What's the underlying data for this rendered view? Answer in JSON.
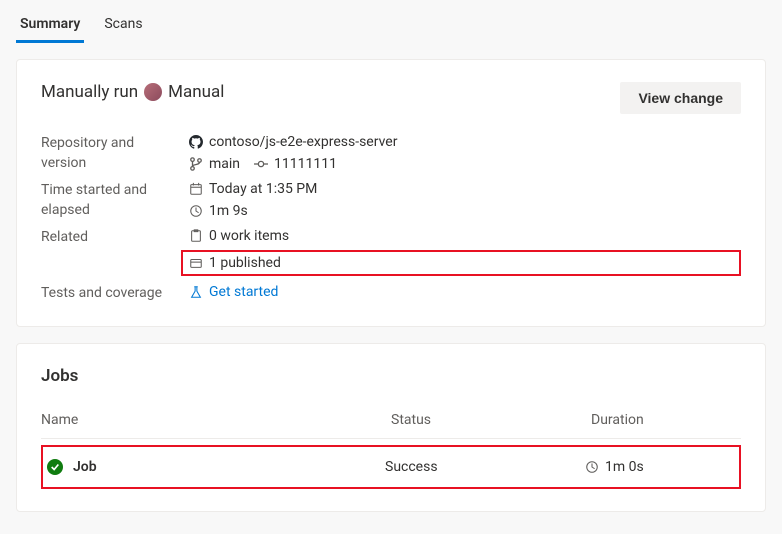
{
  "tabs": {
    "summary": "Summary",
    "scans": "Scans"
  },
  "header": {
    "run_prefix": "Manually run",
    "run_suffix": "Manual",
    "view_change": "View change"
  },
  "details": {
    "repo_label": "Repository and version",
    "repo_value": "contoso/js-e2e-express-server",
    "branch": "main",
    "commit": "11111111",
    "time_label": "Time started and elapsed",
    "time_started": "Today at 1:35 PM",
    "elapsed": "1m 9s",
    "related_label": "Related",
    "work_items": "0 work items",
    "published": "1 published",
    "tests_label": "Tests and coverage",
    "get_started": "Get started"
  },
  "jobs": {
    "title": "Jobs",
    "columns": {
      "name": "Name",
      "status": "Status",
      "duration": "Duration"
    },
    "row": {
      "name": "Job",
      "status": "Success",
      "duration": "1m 0s"
    }
  }
}
